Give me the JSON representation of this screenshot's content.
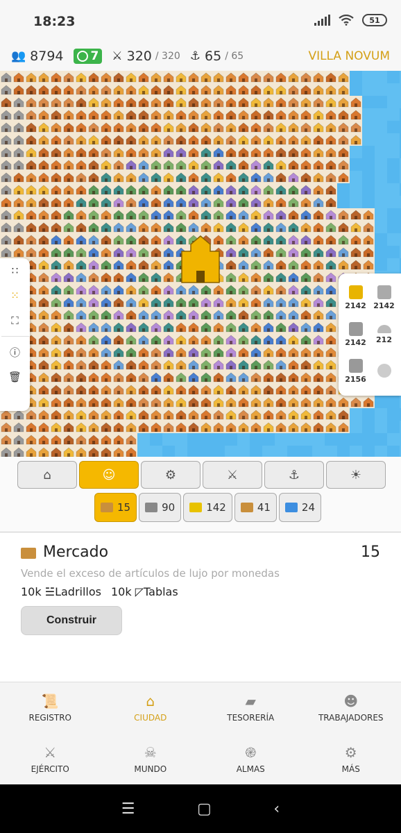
{
  "status": {
    "time": "18:23",
    "battery": "51"
  },
  "resources": {
    "population": "8794",
    "happiness": "7",
    "military": "320",
    "military_max": "/ 320",
    "navy": "65",
    "navy_max": "/ 65",
    "city_name": "VILLA NOVUM"
  },
  "map_panel": {
    "items": [
      {
        "value": "2142",
        "icon": "gold-building-icon"
      },
      {
        "value": "2142",
        "icon": "gray-building-icon"
      },
      {
        "value": "2142",
        "icon": "tower-icon"
      },
      {
        "value": "212",
        "icon": "dome-icon"
      },
      {
        "value": "2156",
        "icon": "temple-icon"
      },
      {
        "value": "",
        "icon": "tree-icon"
      }
    ]
  },
  "categories": [
    "house-icon",
    "smile-icon",
    "gear-icon",
    "sword-icon",
    "anchor-icon",
    "sun-icon"
  ],
  "subcategories": [
    {
      "count": "15",
      "icon": "market-icon"
    },
    {
      "count": "90",
      "icon": "stairs-icon"
    },
    {
      "count": "142",
      "icon": "bars-icon"
    },
    {
      "count": "41",
      "icon": "mill-icon"
    },
    {
      "count": "24",
      "icon": "shirt-icon"
    }
  ],
  "detail": {
    "name": "Mercado",
    "count": "15",
    "description": "Vende el exceso de artículos de lujo por monedas",
    "cost1": "10k",
    "cost1_label": "Ladrillos",
    "cost2": "10k",
    "cost2_label": "Tablas",
    "build_label": "Construir"
  },
  "nav": [
    {
      "label": "REGISTRO",
      "icon": "scroll-icon"
    },
    {
      "label": "CIUDAD",
      "icon": "house-icon"
    },
    {
      "label": "TESORERÍA",
      "icon": "ingot-icon"
    },
    {
      "label": "TRABAJADORES",
      "icon": "workers-icon"
    },
    {
      "label": "EJÉRCITO",
      "icon": "sword-icon"
    },
    {
      "label": "MUNDO",
      "icon": "skull-icon"
    },
    {
      "label": "ALMAS",
      "icon": "spiral-icon"
    },
    {
      "label": "MÁS",
      "icon": "gear-icon"
    }
  ],
  "colors": {
    "accent": "#d4a017",
    "active_tab": "#f5b800",
    "water": "#55b7ef",
    "happy": "#3cb44a"
  }
}
